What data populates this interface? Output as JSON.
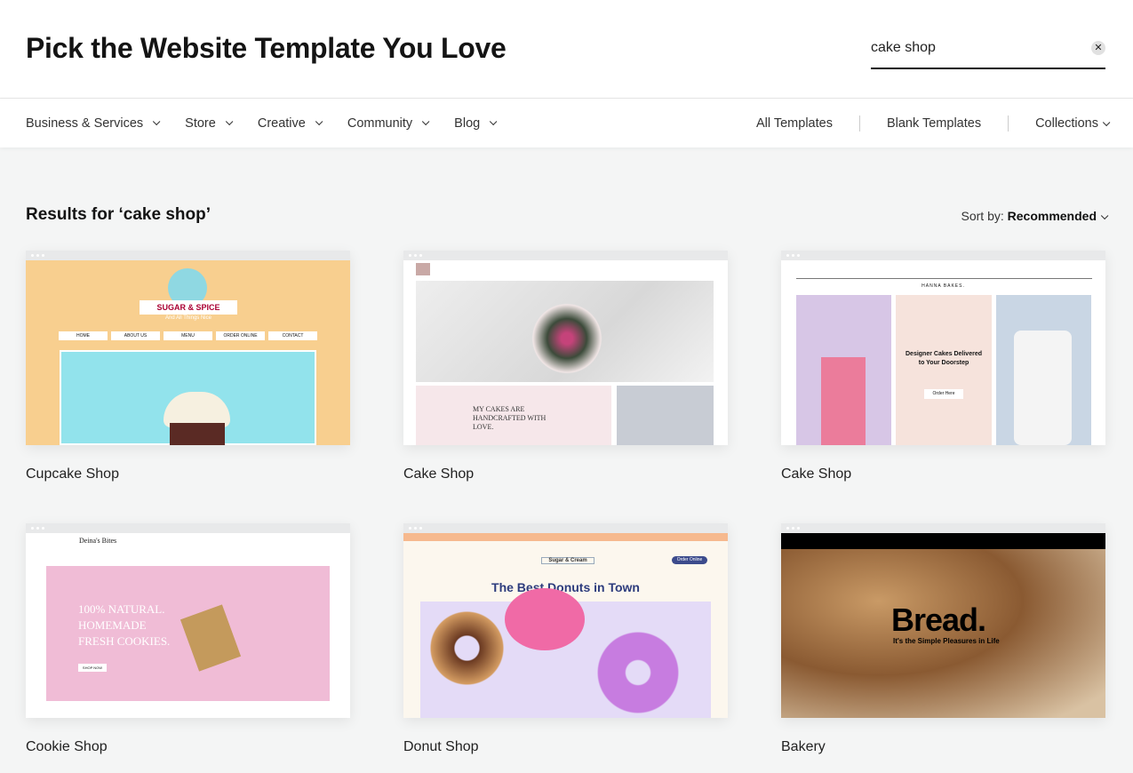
{
  "header": {
    "title": "Pick the Website Template You Love",
    "search": {
      "value": "cake shop",
      "clear_icon": "close-icon"
    }
  },
  "nav": {
    "categories": [
      {
        "label": "Business & Services"
      },
      {
        "label": "Store"
      },
      {
        "label": "Creative"
      },
      {
        "label": "Community"
      },
      {
        "label": "Blog"
      }
    ],
    "right": {
      "all": "All Templates",
      "blank": "Blank Templates",
      "collections": "Collections"
    }
  },
  "results": {
    "heading": "Results for ‘cake shop’",
    "sort_label": "Sort by:",
    "sort_value": "Recommended"
  },
  "templates": [
    {
      "name": "Cupcake Shop",
      "preview": {
        "brand": "SUGAR & SPICE",
        "tagline": "And All Things Nice",
        "menu": [
          "HOME",
          "ABOUT US",
          "MENU",
          "ORDER ONLINE",
          "CONTACT"
        ]
      }
    },
    {
      "name": "Cake Shop",
      "preview": {
        "headline": "MY CAKES ARE HANDCRAFTED WITH LOVE."
      }
    },
    {
      "name": "Cake Shop",
      "preview": {
        "brand": "HANNA BAKES.",
        "headline": "Designer Cakes Delivered to Your Doorstep",
        "button": "Order Here"
      }
    },
    {
      "name": "Cookie Shop",
      "preview": {
        "brand": "Deina's Bites",
        "headline": "100% NATURAL. HOMEMADE FRESH COOKIES.",
        "button": "SHOP NOW"
      }
    },
    {
      "name": "Donut Shop",
      "preview": {
        "brand": "Sugar & Cream",
        "headline": "The Best Donuts in Town",
        "button": "Order Online"
      }
    },
    {
      "name": "Bakery",
      "preview": {
        "headline": "Bread.",
        "tagline": "It's the Simple Pleasures in Life"
      }
    }
  ]
}
